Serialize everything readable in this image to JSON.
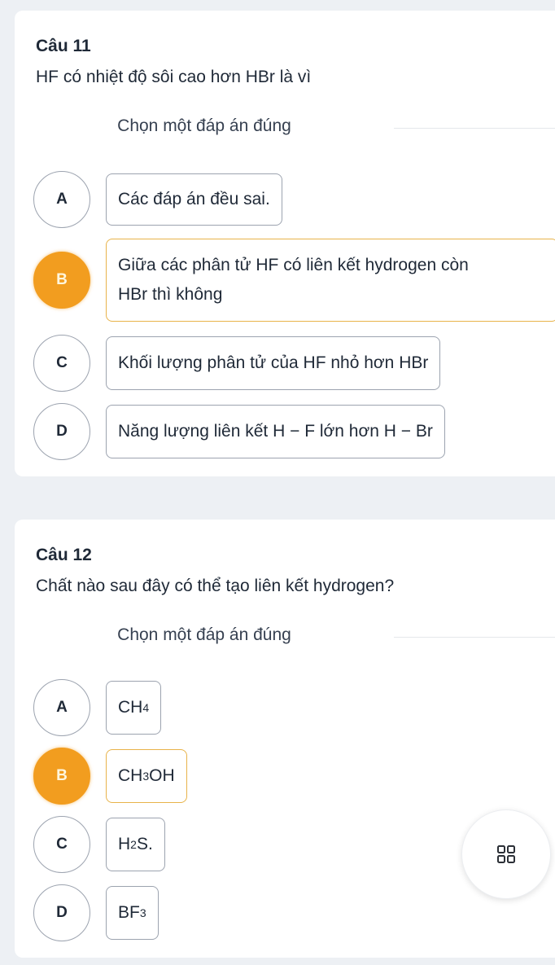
{
  "questions": [
    {
      "title": "Câu 11",
      "text": "HF có nhiệt độ sôi cao hơn HBr là vì",
      "instruction": "Chọn một đáp án đúng",
      "selected": "B",
      "options": [
        {
          "letter": "A",
          "text": "Các đáp án đều sai."
        },
        {
          "letter": "B",
          "line1": "Giữa các phân tử HF có liên kết hydrogen còn",
          "line2": "HBr thì không"
        },
        {
          "letter": "C",
          "text": "Khối lượng phân tử của HF nhỏ hơn HBr"
        },
        {
          "letter": "D",
          "text": "Năng lượng liên kết H − F lớn hơn H − Br"
        }
      ]
    },
    {
      "title": "Câu 12",
      "text": "Chất nào sau đây có thể tạo liên kết hydrogen?",
      "instruction": "Chọn một đáp án đúng",
      "selected": "B",
      "options": [
        {
          "letter": "A",
          "pre": "CH",
          "sub": "4",
          "post": ""
        },
        {
          "letter": "B",
          "pre": "CH",
          "sub": "3",
          "post": "OH"
        },
        {
          "letter": "C",
          "pre": "H",
          "sub": "2",
          "post": "S."
        },
        {
          "letter": "D",
          "pre": "BF",
          "sub": "3",
          "post": ""
        }
      ]
    }
  ],
  "fab": {
    "icon": "grid-icon"
  },
  "colors": {
    "selected": "#f29d1f",
    "background": "#edf0f4"
  }
}
